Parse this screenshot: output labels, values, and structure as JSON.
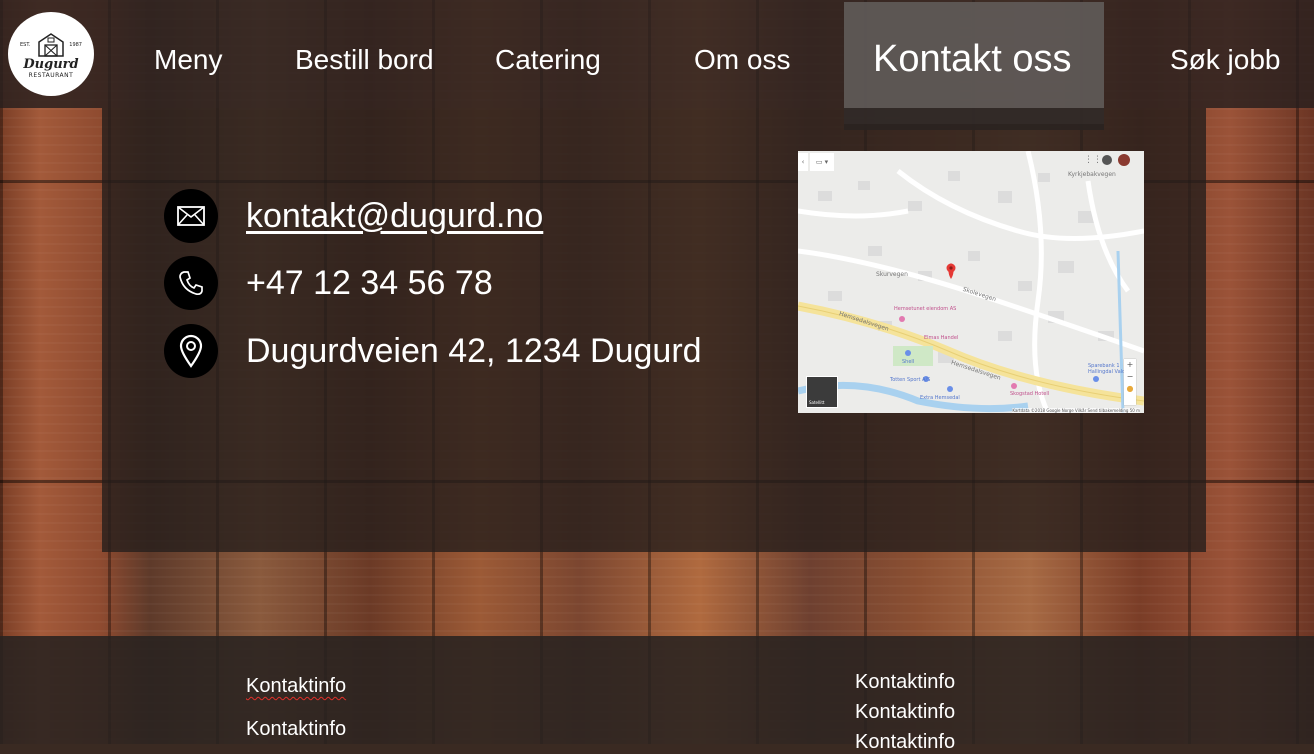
{
  "logo": {
    "name": "Dugurd",
    "subtitle": "RESTAURANT",
    "est": "EST.",
    "year": "1987"
  },
  "nav": {
    "items": [
      {
        "label": "Meny"
      },
      {
        "label": "Bestill bord"
      },
      {
        "label": "Catering"
      },
      {
        "label": "Om oss"
      },
      {
        "label": "Kontakt oss"
      },
      {
        "label": "Søk jobb"
      }
    ],
    "active": "Kontakt oss"
  },
  "contact": {
    "email": "kontakt@dugurd.no",
    "phone": "+47 12 34 56 78",
    "address": "Dugurdveien 42, 1234 Dugurd",
    "icons": [
      "envelope-icon",
      "phone-icon",
      "location-pin-icon"
    ]
  },
  "map": {
    "streets": [
      "Skurvegen",
      "Hemsedalsvegen",
      "Kyrkjebakvegen",
      "Skolevegen",
      "Hemsedalsvegen"
    ],
    "places": [
      "Hemsetunet eiendom AS",
      "Elmas Handel",
      "Shell",
      "Totten Sport A/S",
      "Extra Hemsedal",
      "Sparebank 1 Hallingdal Valdres",
      "Skogstad Hotell"
    ],
    "satellite_label": "Satellitt",
    "attribution": "Kartdata ©2018 Google   Norge   Vilkår   Send tilbakemelding   50 m"
  },
  "footer": {
    "left": [
      "Kontaktinfo",
      "Kontaktinfo"
    ],
    "right": [
      "Kontaktinfo",
      "Kontaktinfo",
      "Kontaktinfo"
    ]
  },
  "colors": {
    "topbar": "#28201e",
    "active_tab": "#5f5a58",
    "panel": "#261e1c",
    "map_pin": "#e53935"
  }
}
